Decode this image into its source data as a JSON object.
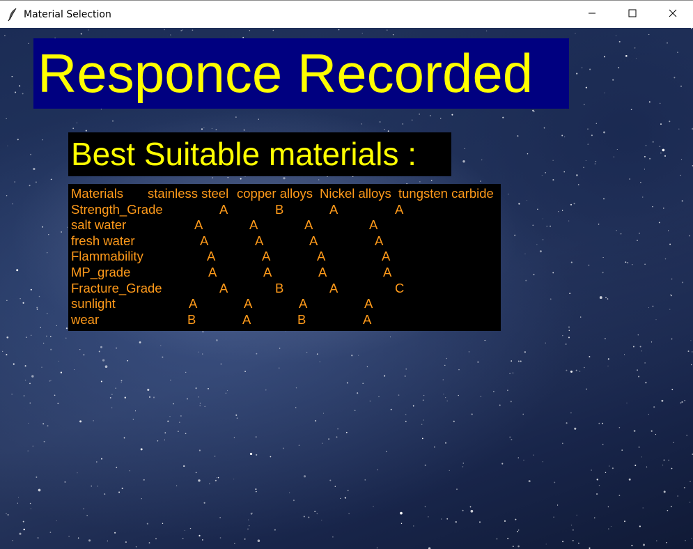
{
  "window": {
    "title": "Material Selection",
    "icon": "feather-icon",
    "controls": [
      "minimize-icon",
      "maximize-icon",
      "close-icon"
    ]
  },
  "banner": {
    "text": "Responce Recorded",
    "background": "#000080",
    "color": "#ffff00"
  },
  "subtitle": {
    "text": "Best Suitable materials :",
    "background": "#000000",
    "color": "#ffff00"
  },
  "results": {
    "text_color": "#ff9a1a",
    "background": "#000000",
    "header": {
      "label": "Materials",
      "columns": [
        "stainless steel",
        "copper alloys",
        "Nickel alloys",
        "tungsten carbide"
      ]
    },
    "rows": [
      {
        "property": "Strength_Grade",
        "values": [
          "A",
          "B",
          "A",
          "A"
        ]
      },
      {
        "property": "salt water",
        "values": [
          "A",
          "A",
          "A",
          "A"
        ]
      },
      {
        "property": "fresh water",
        "values": [
          "A",
          "A",
          "A",
          "A"
        ]
      },
      {
        "property": "Flammability",
        "values": [
          "A",
          "A",
          "A",
          "A"
        ]
      },
      {
        "property": "MP_grade",
        "values": [
          "A",
          "A",
          "A",
          "A"
        ]
      },
      {
        "property": "Fracture_Grade",
        "values": [
          "A",
          "B",
          "A",
          "C"
        ]
      },
      {
        "property": "sunlight",
        "values": [
          "A",
          "A",
          "A",
          "A"
        ]
      },
      {
        "property": "wear",
        "values": [
          "B",
          "A",
          "B",
          "A"
        ]
      }
    ]
  }
}
